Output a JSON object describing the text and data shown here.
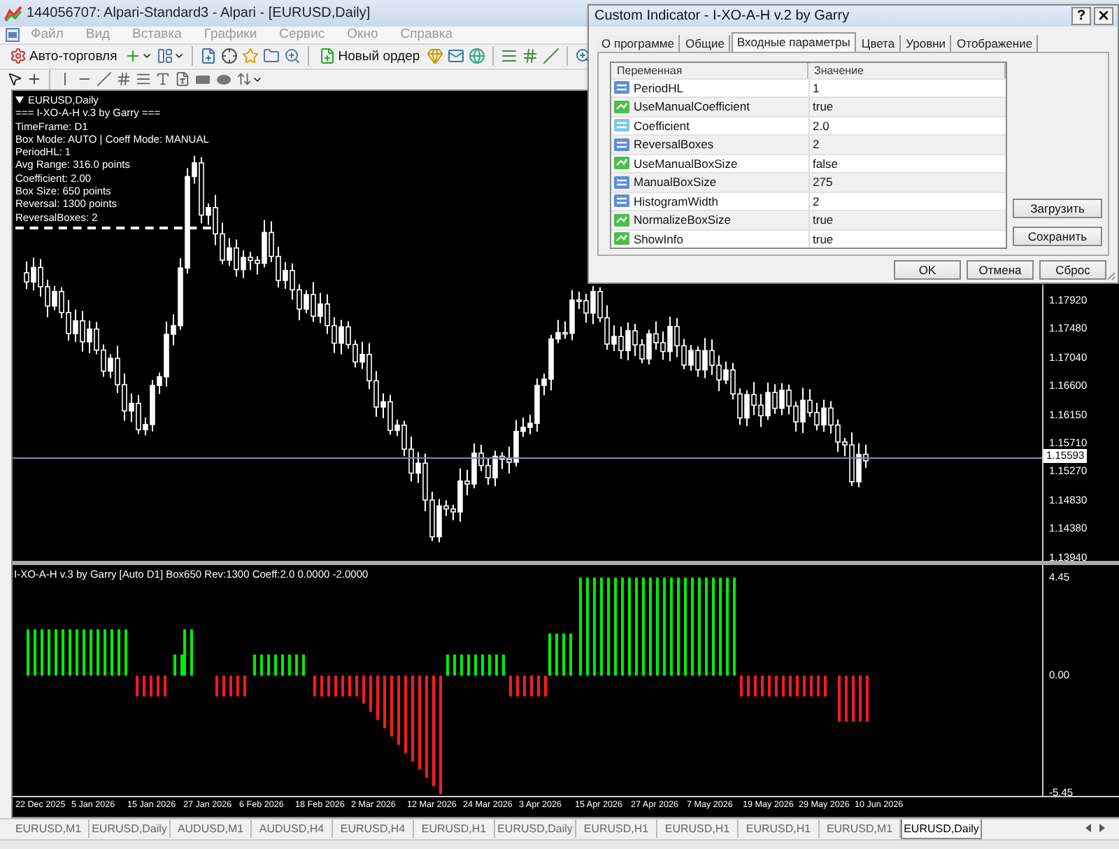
{
  "window": {
    "title": "144056707: Alpari-Standard3 - Alpari - [EURUSD,Daily]"
  },
  "menu": [
    "Файл",
    "Вид",
    "Вставка",
    "Графики",
    "Сервис",
    "Окно",
    "Справка"
  ],
  "toolbar": {
    "buttons": [
      "Авто-торговля",
      "Новый ордер"
    ]
  },
  "chart": {
    "symbol": "EURUSD,Daily",
    "info_lines": [
      "=== I-XO-A-H v.3 by Garry ===",
      "TimeFrame: D1",
      "Box Mode: AUTO | Coeff Mode: MANUAL",
      "PeriodHL: 1",
      "Avg Range: 316.0 points",
      "Coefficient: 2.00",
      "Box Size: 650 points",
      "Reversal: 1300 points",
      "ReversalBoxes: 2"
    ],
    "price_ticks": [
      "1.17920",
      "1.17480",
      "1.17040",
      "1.16600",
      "1.16150",
      "1.15710",
      "1.15270",
      "1.14830",
      "1.14380",
      "1.13940"
    ],
    "current_price": "1.15593"
  },
  "indicator": {
    "label": "I-XO-A-H v.3 by Garry [Auto D1] Box650 Rev:1300 Coeff:2.0 0.0000 -2.0000",
    "ticks": [
      "4.45",
      "0.00",
      "-5.45"
    ]
  },
  "time_axis": [
    "22 Dec 2025",
    "5 Jan 2026",
    "15 Jan 2026",
    "27 Jan 2026",
    "6 Feb 2026",
    "18 Feb 2026",
    "2 Mar 2026",
    "12 Mar 2026",
    "24 Mar 2026",
    "3 Apr 2026",
    "15 Apr 2026",
    "27 Apr 2026",
    "7 May 2026",
    "19 May 2026",
    "29 May 2026",
    "10 Jun 2026"
  ],
  "chart_tabs": [
    {
      "label": "EURUSD,M1",
      "selected": false
    },
    {
      "label": "EURUSD,Daily",
      "selected": false
    },
    {
      "label": "AUDUSD,M1",
      "selected": false
    },
    {
      "label": "AUDUSD,H4",
      "selected": false
    },
    {
      "label": "EURUSD,H4",
      "selected": false
    },
    {
      "label": "EURUSD,H1",
      "selected": false
    },
    {
      "label": "EURUSD,Daily",
      "selected": false
    },
    {
      "label": "EURUSD,H1",
      "selected": false
    },
    {
      "label": "EURUSD,H1",
      "selected": false
    },
    {
      "label": "EURUSD,H1",
      "selected": false
    },
    {
      "label": "EURUSD,M1",
      "selected": false
    },
    {
      "label": "EURUSD,Daily",
      "selected": true
    }
  ],
  "dialog": {
    "title": "Custom Indicator - I-XO-A-H v.2 by Garry",
    "help": "?",
    "tabs": [
      {
        "label": "О программе",
        "selected": false
      },
      {
        "label": "Общие",
        "selected": false
      },
      {
        "label": "Входные параметры",
        "selected": true
      },
      {
        "label": "Цвета",
        "selected": false
      },
      {
        "label": "Уровни",
        "selected": false
      },
      {
        "label": "Отображение",
        "selected": false
      }
    ],
    "columns": [
      "Переменная",
      "Значение"
    ],
    "rows": [
      {
        "kind": "int",
        "name": "PeriodHL",
        "value": "1"
      },
      {
        "kind": "bool",
        "name": "UseManualCoefficient",
        "value": "true"
      },
      {
        "kind": "double",
        "name": "Coefficient",
        "value": "2.0"
      },
      {
        "kind": "int",
        "name": "ReversalBoxes",
        "value": "2"
      },
      {
        "kind": "bool",
        "name": "UseManualBoxSize",
        "value": "false"
      },
      {
        "kind": "int",
        "name": "ManualBoxSize",
        "value": "275"
      },
      {
        "kind": "int",
        "name": "HistogramWidth",
        "value": "2"
      },
      {
        "kind": "bool",
        "name": "NormalizeBoxSize",
        "value": "true"
      },
      {
        "kind": "bool",
        "name": "ShowInfo",
        "value": "true"
      }
    ],
    "side_buttons": [
      "Загрузить",
      "Сохранить"
    ],
    "buttons": [
      "OK",
      "Отмена",
      "Сброс"
    ]
  }
}
